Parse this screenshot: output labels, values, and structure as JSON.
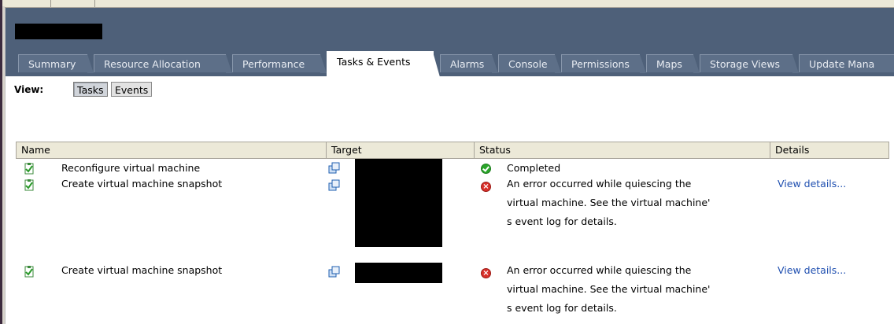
{
  "header": {
    "title": "",
    "tabs": [
      {
        "label": "Summary"
      },
      {
        "label": "Resource Allocation"
      },
      {
        "label": "Performance"
      },
      {
        "label": "Tasks & Events",
        "active": true
      },
      {
        "label": "Alarms"
      },
      {
        "label": "Console"
      },
      {
        "label": "Permissions"
      },
      {
        "label": "Maps"
      },
      {
        "label": "Storage Views"
      },
      {
        "label": "Update Mana"
      }
    ]
  },
  "viewbar": {
    "label": "View:",
    "buttons": [
      {
        "label": "Tasks",
        "pressed": true
      },
      {
        "label": "Events",
        "pressed": false
      }
    ]
  },
  "table": {
    "columns": [
      "Name",
      "Target",
      "Status",
      "Details"
    ],
    "rows": [
      {
        "name": "Reconfigure virtual machine",
        "status_icon": "success-icon",
        "status_lines": [
          "Completed"
        ],
        "details": ""
      },
      {
        "name": "Create virtual machine snapshot",
        "status_icon": "error-icon",
        "status_lines": [
          "An error occurred while quiescing the",
          "virtual machine. See the virtual machine'",
          "s event log for details."
        ],
        "details": "View details..."
      },
      {
        "name": "Create virtual machine snapshot",
        "status_icon": "error-icon",
        "status_lines": [
          "An error occurred while quiescing the",
          "virtual machine. See the virtual machine'",
          "s event log for details."
        ],
        "details": "View details..."
      }
    ]
  },
  "colors": {
    "header_bg": "#4e6079",
    "link": "#1f4fb0",
    "success": "#2aa52a",
    "error": "#d8302a"
  }
}
